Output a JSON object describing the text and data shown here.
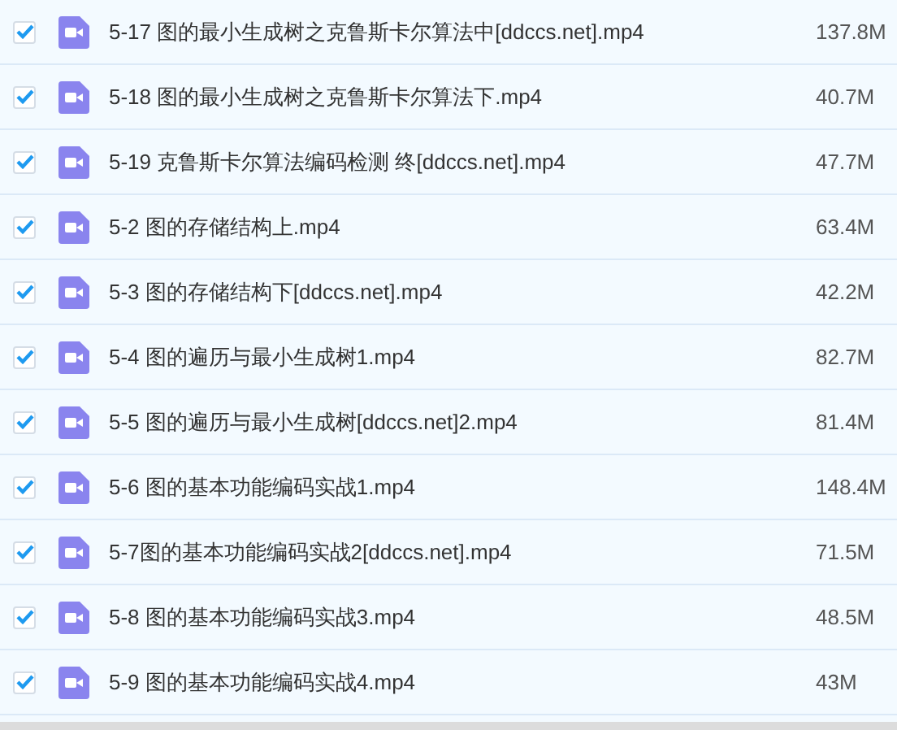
{
  "files": [
    {
      "name": "5-17 图的最小生成树之克鲁斯卡尔算法中[ddccs.net].mp4",
      "size": "137.8M",
      "checked": true
    },
    {
      "name": "5-18 图的最小生成树之克鲁斯卡尔算法下.mp4",
      "size": "40.7M",
      "checked": true
    },
    {
      "name": "5-19 克鲁斯卡尔算法编码检测 终[ddccs.net].mp4",
      "size": "47.7M",
      "checked": true
    },
    {
      "name": "5-2 图的存储结构上.mp4",
      "size": "63.4M",
      "checked": true
    },
    {
      "name": "5-3 图的存储结构下[ddccs.net].mp4",
      "size": "42.2M",
      "checked": true
    },
    {
      "name": "5-4 图的遍历与最小生成树1.mp4",
      "size": "82.7M",
      "checked": true
    },
    {
      "name": "5-5 图的遍历与最小生成树[ddccs.net]2.mp4",
      "size": "81.4M",
      "checked": true
    },
    {
      "name": "5-6 图的基本功能编码实战1.mp4",
      "size": "148.4M",
      "checked": true
    },
    {
      "name": "5-7图的基本功能编码实战2[ddccs.net].mp4",
      "size": "71.5M",
      "checked": true
    },
    {
      "name": "5-8 图的基本功能编码实战3.mp4",
      "size": "48.5M",
      "checked": true
    },
    {
      "name": "5-9 图的基本功能编码实战4.mp4",
      "size": "43M",
      "checked": true
    }
  ]
}
